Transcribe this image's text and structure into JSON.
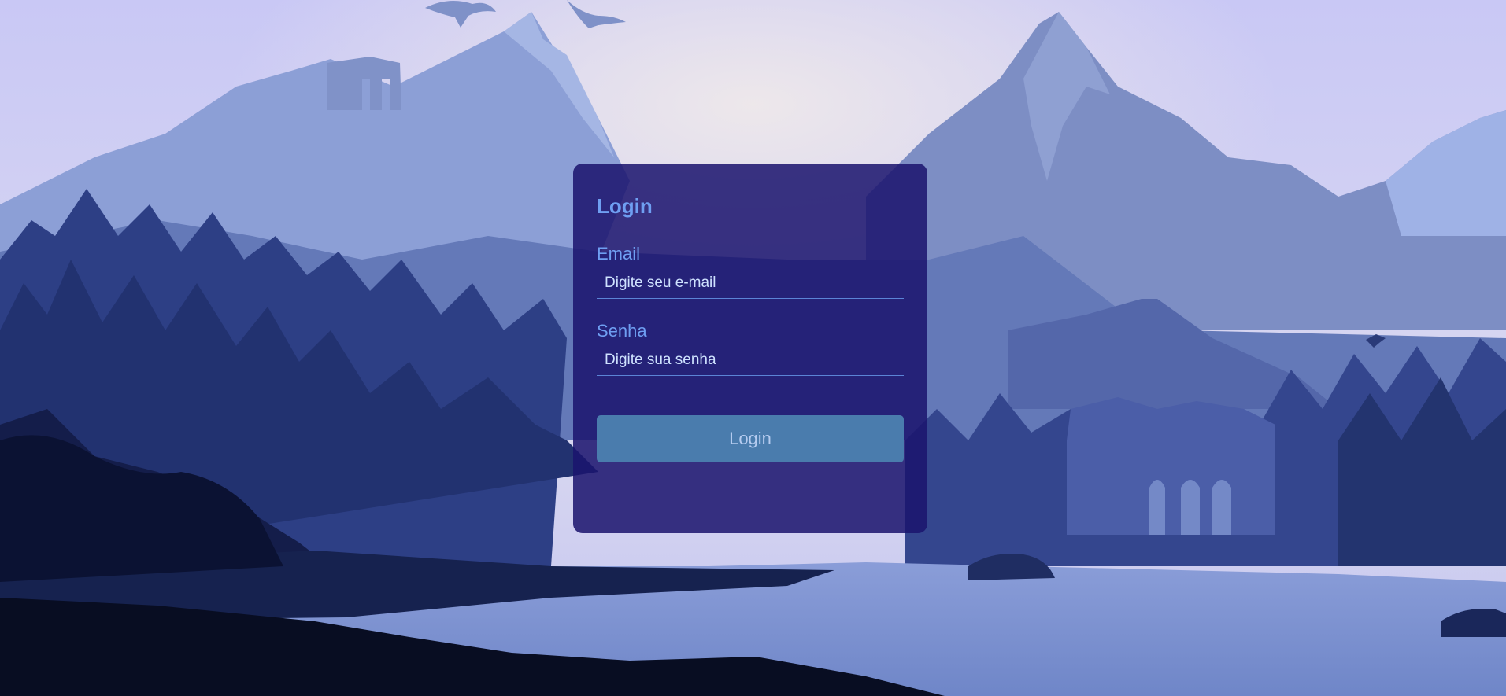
{
  "login_form": {
    "title": "Login",
    "email_label": "Email",
    "email_placeholder": "Digite seu e-mail",
    "password_label": "Senha",
    "password_placeholder": "Digite sua senha",
    "submit_label": "Login"
  },
  "colors": {
    "card_background": "#1b146e",
    "accent_text": "#6f9ff2",
    "button_background": "#4a7cad",
    "sky": "#cdcdf6"
  }
}
